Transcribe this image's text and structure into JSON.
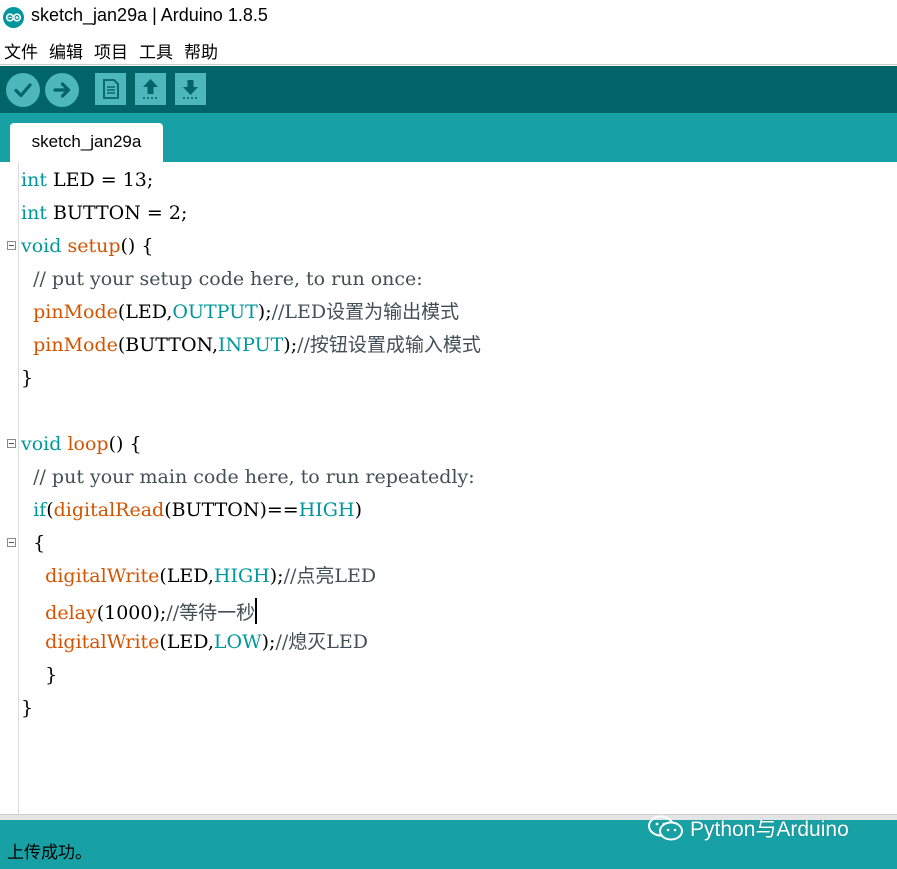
{
  "window": {
    "title": "sketch_jan29a | Arduino 1.8.5"
  },
  "menu": {
    "items": [
      "文件",
      "编辑",
      "项目",
      "工具",
      "帮助"
    ]
  },
  "toolbar": {
    "buttons": [
      {
        "name": "verify",
        "icon": "check-icon"
      },
      {
        "name": "upload",
        "icon": "arrow-right-icon"
      },
      {
        "name": "new",
        "icon": "document-icon"
      },
      {
        "name": "open",
        "icon": "arrow-up-icon"
      },
      {
        "name": "save",
        "icon": "arrow-down-icon"
      }
    ]
  },
  "tabs": [
    {
      "label": "sketch_jan29a",
      "active": true
    }
  ],
  "editor": {
    "lines": [
      {
        "indent": "",
        "tokens": [
          {
            "t": "int",
            "c": "kw"
          },
          {
            "t": " LED = 13;",
            "c": ""
          }
        ]
      },
      {
        "indent": "",
        "tokens": [
          {
            "t": "int",
            "c": "kw"
          },
          {
            "t": " BUTTON = 2;",
            "c": ""
          }
        ]
      },
      {
        "indent": "",
        "fold": true,
        "tokens": [
          {
            "t": "void",
            "c": "kw"
          },
          {
            "t": " ",
            "c": ""
          },
          {
            "t": "setup",
            "c": "fn"
          },
          {
            "t": "() {",
            "c": ""
          }
        ]
      },
      {
        "indent": "  ",
        "tokens": [
          {
            "t": "// put your setup code here, to run once:",
            "c": "cm"
          }
        ]
      },
      {
        "indent": "  ",
        "tokens": [
          {
            "t": "pinMode",
            "c": "fn"
          },
          {
            "t": "(LED,",
            "c": ""
          },
          {
            "t": "OUTPUT",
            "c": "cn"
          },
          {
            "t": ");",
            "c": ""
          },
          {
            "t": "//LED设置为输出模式",
            "c": "cm"
          }
        ]
      },
      {
        "indent": "  ",
        "tokens": [
          {
            "t": "pinMode",
            "c": "fn"
          },
          {
            "t": "(BUTTON,",
            "c": ""
          },
          {
            "t": "INPUT",
            "c": "cn"
          },
          {
            "t": ");",
            "c": ""
          },
          {
            "t": "//按钮设置成输入模式",
            "c": "cm"
          }
        ]
      },
      {
        "indent": "",
        "tokens": [
          {
            "t": "}",
            "c": ""
          }
        ]
      },
      {
        "indent": "",
        "tokens": [
          {
            "t": "",
            "c": ""
          }
        ]
      },
      {
        "indent": "",
        "fold": true,
        "tokens": [
          {
            "t": "void",
            "c": "kw"
          },
          {
            "t": " ",
            "c": ""
          },
          {
            "t": "loop",
            "c": "fn"
          },
          {
            "t": "() {",
            "c": ""
          }
        ]
      },
      {
        "indent": "  ",
        "tokens": [
          {
            "t": "// put your main code here, to run repeatedly:",
            "c": "cm"
          }
        ]
      },
      {
        "indent": "  ",
        "tokens": [
          {
            "t": "if",
            "c": "kw"
          },
          {
            "t": "(",
            "c": ""
          },
          {
            "t": "digitalRead",
            "c": "fn"
          },
          {
            "t": "(BUTTON)==",
            "c": ""
          },
          {
            "t": "HIGH",
            "c": "cn"
          },
          {
            "t": ")",
            "c": ""
          }
        ]
      },
      {
        "indent": "  ",
        "fold": true,
        "tokens": [
          {
            "t": "{",
            "c": ""
          }
        ]
      },
      {
        "indent": "    ",
        "tokens": [
          {
            "t": "digitalWrite",
            "c": "fn"
          },
          {
            "t": "(LED,",
            "c": ""
          },
          {
            "t": "HIGH",
            "c": "cn"
          },
          {
            "t": ");",
            "c": ""
          },
          {
            "t": "//点亮LED",
            "c": "cm"
          }
        ]
      },
      {
        "indent": "    ",
        "caret": true,
        "tokens": [
          {
            "t": "delay",
            "c": "fn"
          },
          {
            "t": "(1000);",
            "c": ""
          },
          {
            "t": "//等待一秒",
            "c": "cm"
          }
        ]
      },
      {
        "indent": "    ",
        "tokens": [
          {
            "t": "digitalWrite",
            "c": "fn"
          },
          {
            "t": "(LED,",
            "c": ""
          },
          {
            "t": "LOW",
            "c": "cn"
          },
          {
            "t": ");",
            "c": ""
          },
          {
            "t": "//熄灭LED",
            "c": "cm"
          }
        ]
      },
      {
        "indent": "    ",
        "tokens": [
          {
            "t": "}",
            "c": ""
          }
        ]
      },
      {
        "indent": "",
        "tokens": [
          {
            "t": "}",
            "c": ""
          }
        ]
      }
    ]
  },
  "status": {
    "message": "上传成功。"
  },
  "watermark": {
    "text": "Python与Arduino"
  },
  "colors": {
    "toolbar_bg": "#006468",
    "tab_bg": "#17a1a5",
    "button_bg": "#4db7bb",
    "keyword": "#00979c",
    "function": "#d35400",
    "comment": "#434f54"
  }
}
